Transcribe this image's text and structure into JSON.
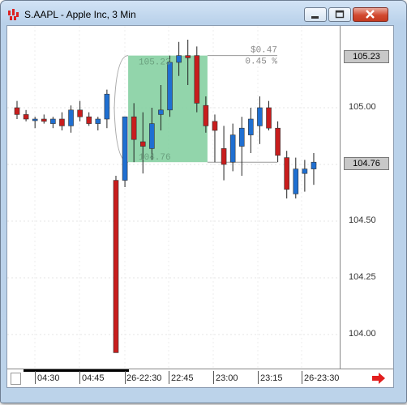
{
  "window": {
    "title": "S.AAPL - Apple Inc, 3 Min"
  },
  "annotation": {
    "price_change": "$0.47",
    "pct_change": "0.45 %",
    "top_price": "105.23",
    "bottom_price": "104.76"
  },
  "y_axis": {
    "ticks": [
      "105.00",
      "104.50",
      "104.25",
      "104.00"
    ],
    "highlights": [
      "105.23",
      "104.76"
    ]
  },
  "x_axis": {
    "ticks": [
      "04:30",
      "04:45",
      "26-22:30",
      "22:45",
      "23:00",
      "23:15",
      "26-23:30"
    ]
  },
  "colors": {
    "up": "#1f6fd1",
    "down": "#c81d1d",
    "box": "#7fce9c"
  },
  "chart_data": {
    "type": "candlestick",
    "title": "S.AAPL - Apple Inc, 3 Min",
    "candles": [
      {
        "o": 105.0,
        "h": 105.03,
        "l": 104.95,
        "c": 104.97
      },
      {
        "o": 104.97,
        "h": 104.99,
        "l": 104.94,
        "c": 104.95
      },
      {
        "o": 104.95,
        "h": 104.96,
        "l": 104.91,
        "c": 104.95
      },
      {
        "o": 104.95,
        "h": 104.97,
        "l": 104.93,
        "c": 104.94
      },
      {
        "o": 104.93,
        "h": 104.96,
        "l": 104.91,
        "c": 104.95
      },
      {
        "o": 104.95,
        "h": 104.98,
        "l": 104.9,
        "c": 104.92
      },
      {
        "o": 104.92,
        "h": 105.01,
        "l": 104.89,
        "c": 104.99
      },
      {
        "o": 104.99,
        "h": 105.03,
        "l": 104.94,
        "c": 104.96
      },
      {
        "o": 104.96,
        "h": 104.98,
        "l": 104.92,
        "c": 104.93
      },
      {
        "o": 104.93,
        "h": 104.96,
        "l": 104.9,
        "c": 104.95
      },
      {
        "o": 104.95,
        "h": 105.08,
        "l": 104.91,
        "c": 105.06
      },
      {
        "o": 104.68,
        "h": 104.7,
        "l": 103.92,
        "c": 103.92
      },
      {
        "o": 104.68,
        "h": 104.96,
        "l": 104.65,
        "c": 104.96
      },
      {
        "o": 104.96,
        "h": 105.02,
        "l": 104.76,
        "c": 104.86
      },
      {
        "o": 104.85,
        "h": 104.98,
        "l": 104.71,
        "c": 104.83
      },
      {
        "o": 104.82,
        "h": 105.0,
        "l": 104.77,
        "c": 104.93
      },
      {
        "o": 104.97,
        "h": 105.1,
        "l": 104.9,
        "c": 104.99
      },
      {
        "o": 104.99,
        "h": 105.23,
        "l": 104.96,
        "c": 105.2
      },
      {
        "o": 105.2,
        "h": 105.29,
        "l": 105.14,
        "c": 105.23
      },
      {
        "o": 105.23,
        "h": 105.3,
        "l": 105.1,
        "c": 105.22
      },
      {
        "o": 105.23,
        "h": 105.27,
        "l": 104.98,
        "c": 105.02
      },
      {
        "o": 105.01,
        "h": 105.05,
        "l": 104.89,
        "c": 104.92
      },
      {
        "o": 104.94,
        "h": 104.97,
        "l": 104.76,
        "c": 104.9
      },
      {
        "o": 104.82,
        "h": 104.92,
        "l": 104.68,
        "c": 104.75
      },
      {
        "o": 104.76,
        "h": 104.93,
        "l": 104.72,
        "c": 104.88
      },
      {
        "o": 104.83,
        "h": 104.96,
        "l": 104.7,
        "c": 104.91
      },
      {
        "o": 104.88,
        "h": 105.0,
        "l": 104.8,
        "c": 104.95
      },
      {
        "o": 104.92,
        "h": 105.05,
        "l": 104.84,
        "c": 105.0
      },
      {
        "o": 105.0,
        "h": 105.03,
        "l": 104.9,
        "c": 104.91
      },
      {
        "o": 104.91,
        "h": 104.94,
        "l": 104.76,
        "c": 104.79
      },
      {
        "o": 104.78,
        "h": 104.81,
        "l": 104.6,
        "c": 104.64
      },
      {
        "o": 104.62,
        "h": 104.78,
        "l": 104.6,
        "c": 104.73
      },
      {
        "o": 104.71,
        "h": 104.77,
        "l": 104.63,
        "c": 104.73
      },
      {
        "o": 104.73,
        "h": 104.8,
        "l": 104.66,
        "c": 104.76
      }
    ],
    "ylim": [
      103.88,
      105.33
    ],
    "grid": true
  }
}
